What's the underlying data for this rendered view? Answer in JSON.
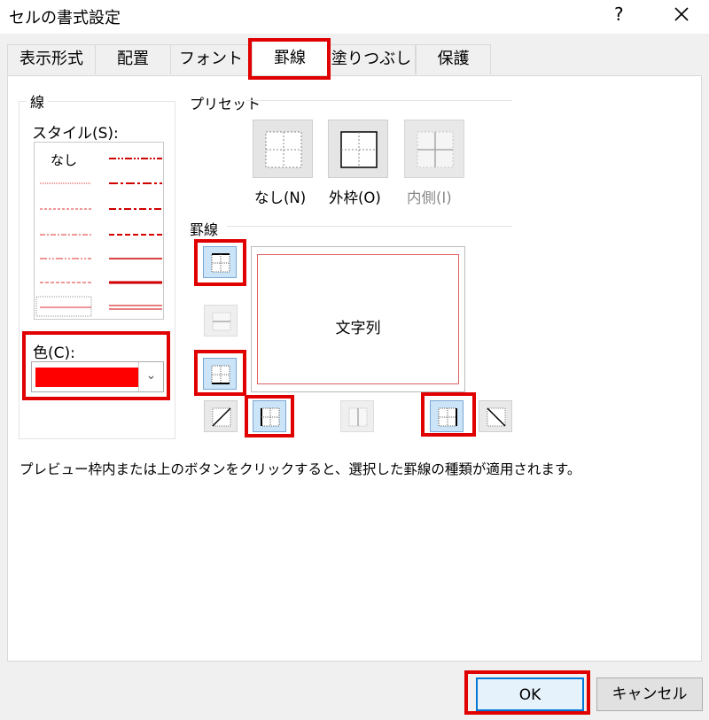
{
  "window": {
    "title": "セルの書式設定",
    "help": "?"
  },
  "tabs": [
    "表示形式",
    "配置",
    "フォント",
    "罫線",
    "塗りつぶし",
    "保護"
  ],
  "line_section": {
    "title": "線",
    "style_label": "スタイル(S):",
    "style_none": "なし",
    "color_label": "色(C):",
    "color_value": "#ff0000"
  },
  "preset_section": {
    "title": "プリセット",
    "none_label": "なし(N)",
    "outline_label": "外枠(O)",
    "inside_label": "内側(I)"
  },
  "border_section": {
    "title": "罫線",
    "preview_text": "文字列"
  },
  "hint": "プレビュー枠内または上のボタンをクリックすると、選択した罫線の種類が適用されます。",
  "buttons": {
    "ok": "OK",
    "cancel": "キャンセル"
  },
  "colors": {
    "accent_red": "#e00000",
    "selected_blue": "#cce4f7"
  }
}
